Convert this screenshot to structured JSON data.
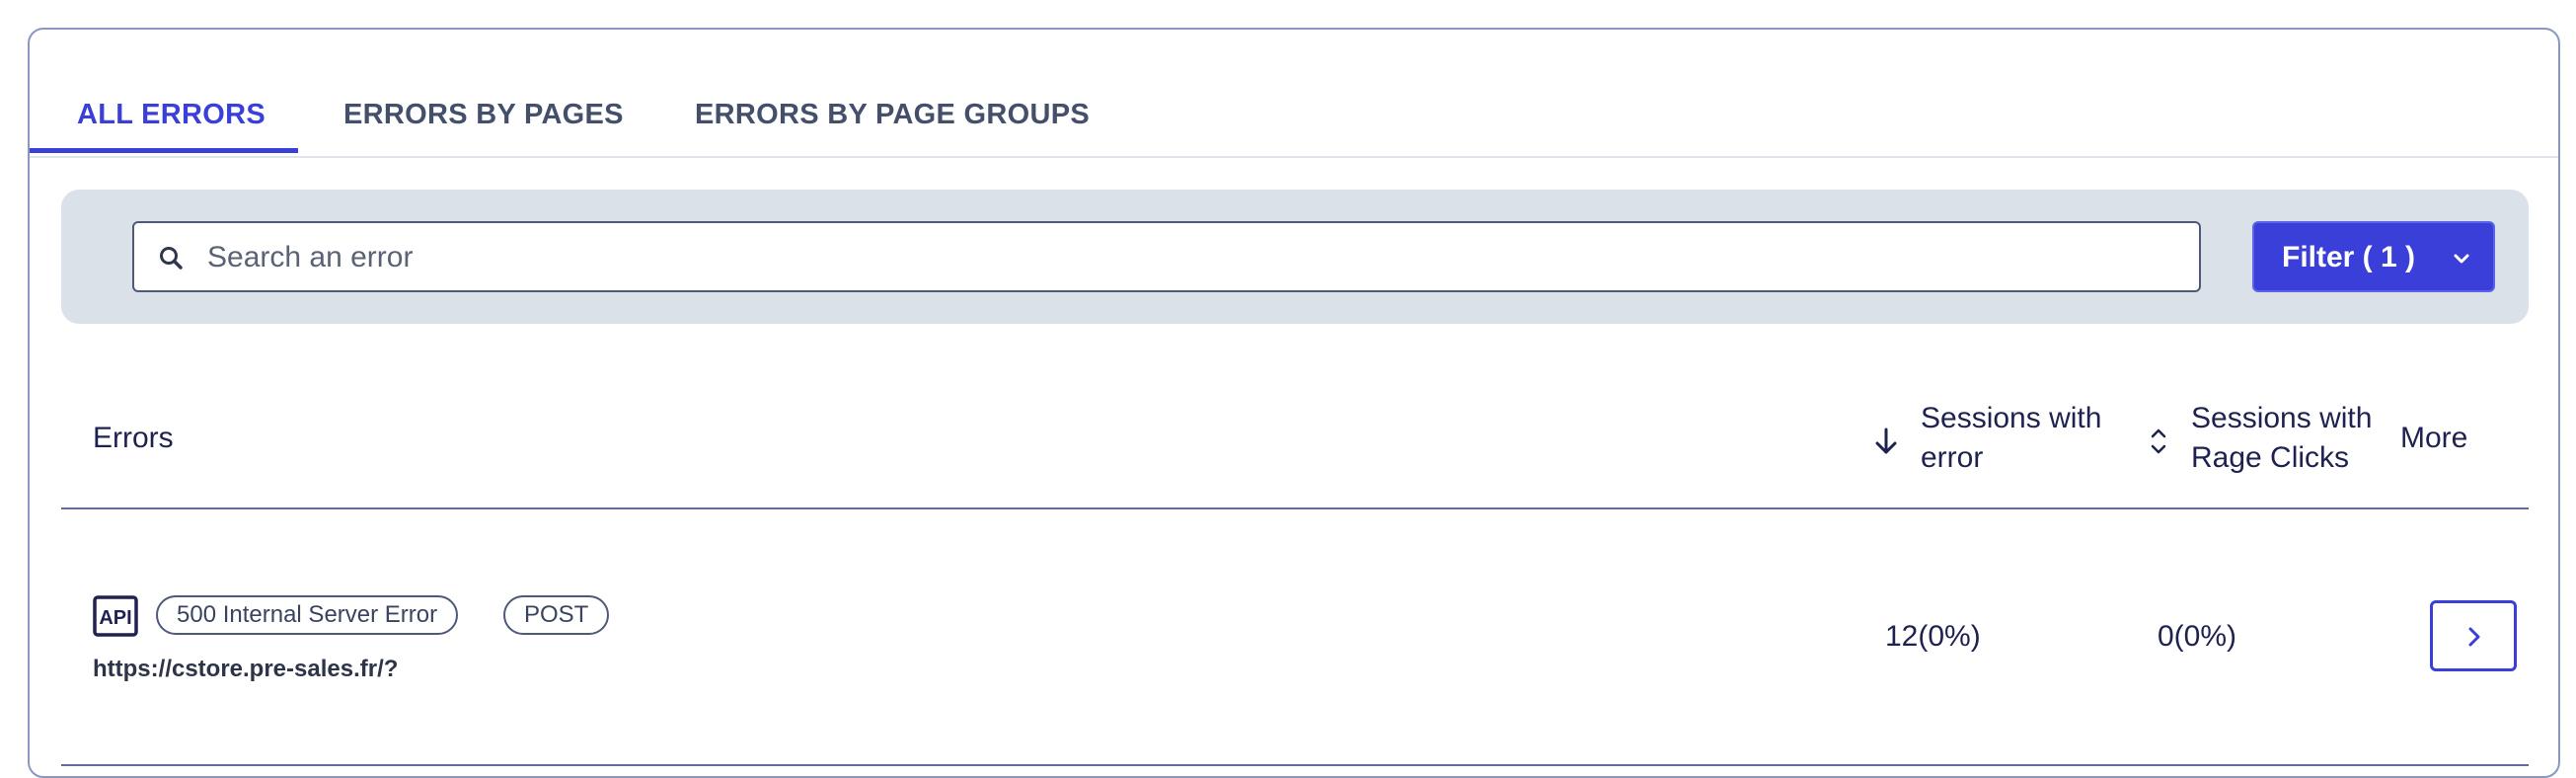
{
  "tabs": [
    {
      "label": "ALL ERRORS",
      "active": true
    },
    {
      "label": "ERRORS BY PAGES",
      "active": false
    },
    {
      "label": "ERRORS BY PAGE GROUPS",
      "active": false
    }
  ],
  "search": {
    "placeholder": "Search an error",
    "value": "",
    "icon": "search-icon"
  },
  "filter": {
    "label": "Filter ( 1 )",
    "icon": "chevron-down-icon"
  },
  "table": {
    "columns": {
      "errors": "Errors",
      "sessions_with_error": "Sessions with error",
      "sessions_with_rage_clicks": "Sessions with Rage Clicks",
      "more": "More"
    },
    "sort": {
      "sessions_with_error": "descending",
      "sessions_with_rage_clicks": "unsorted"
    },
    "rows": [
      {
        "type_icon": "api-icon",
        "type_label": "API",
        "status": "500 Internal Server Error",
        "method": "POST",
        "url": "https://cstore.pre-sales.fr/?",
        "sessions_with_error": "12(0%)",
        "sessions_with_rage_clicks": "0(0%)",
        "more_icon": "chevron-right-icon"
      }
    ]
  },
  "colors": {
    "accent": "#3b3fd9",
    "toolbar_bg": "#dbe1e9",
    "text_primary": "#1f2250",
    "divider": "#5f6e96"
  }
}
